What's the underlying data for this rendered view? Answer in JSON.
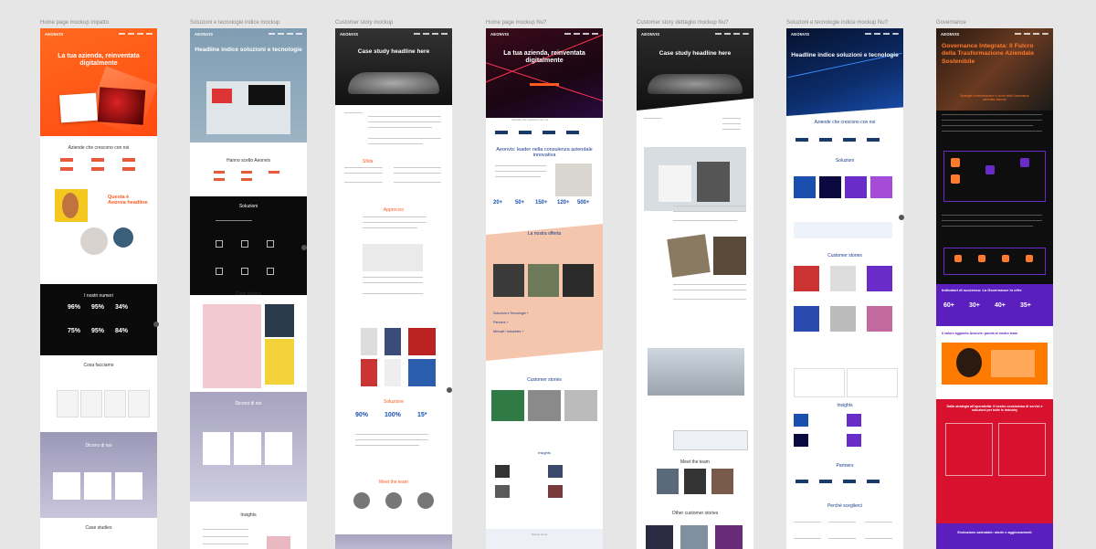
{
  "boards": [
    {
      "label": "Home page mockup impatto",
      "logo": "AEONVIS",
      "hero": "La tua azienda, reinventata digitalmente",
      "sec1": "Aziende che crescono con noi",
      "feature": "Questa è Aeonva headline",
      "numbers": "I nostri numeri",
      "stats": [
        "96%",
        "95%",
        "34%",
        "75%",
        "95%",
        "84%"
      ],
      "cosa": "Cosa facciamo",
      "dicono": "Dicono di noi",
      "case": "Case studies"
    },
    {
      "label": "Soluzioni e tecnologie indice mockup",
      "logo": "AEONVIS",
      "hero": "Headline indice soluzioni e tecnologie",
      "sec1": "Hanno scelto Aeonvis",
      "soluzioni": "Soluzioni",
      "case": "Case studies",
      "dicono": "Dicono di noi",
      "insights": "Insights"
    },
    {
      "label": "Customer story mockup",
      "logo": "AEONVIS",
      "hero": "Case study headline here",
      "sfida": "Sfida",
      "approccio": "Approccio",
      "soluzione": "Soluzione",
      "stats": [
        "90%",
        "100%",
        "15*"
      ],
      "team": "Meet the team"
    },
    {
      "label": "Home page mockup Nu?",
      "logo": "AEONVIS",
      "hero": "La tua azienda, reinventata digitalmente",
      "sec1": "Aziende che crescono con noi",
      "leader": "Aeonvis: leader nella consulenza aziendale innovativa",
      "stats": [
        "20+",
        "50+",
        "150+",
        "120+",
        "500+"
      ],
      "offerte": "La nostra offerta",
      "links": [
        "Soluzioni e Tecnologie +",
        "Partners +",
        "Mercati / Industries +"
      ],
      "stories": "Customer stories",
      "insights": "Insights",
      "dicono": "Dicono di noi"
    },
    {
      "label": "Customer story dettaglio mockup Nu?",
      "logo": "AEONVIS",
      "hero": "Case study headline here",
      "team": "Meet the team",
      "other": "Other customer stories"
    },
    {
      "label": "Soluzioni e tecnologie indice mockup Nu?",
      "logo": "AEONVIS",
      "hero": "Headline indice soluzioni e tecnologie",
      "sec1": "Aziende che crescono con noi",
      "soluzioni": "Soluzioni",
      "stories": "Customer stories",
      "insights": "Insights",
      "partners": "Partners",
      "perche": "Perché sceglierci"
    },
    {
      "label": "Governance",
      "logo": "AEONVIS",
      "hero": "Governance Integrata: Il Fulcro della Trasformazione Aziendale Sostenibile",
      "subhead": "Strategie e trasformazione: il cuore della Governance aziendale Aeonvis",
      "indicatori": "Indicatori di successo: La Governance in cifre",
      "stats": [
        "60+",
        "30+",
        "40+",
        "35+"
      ],
      "valore": "Il valore aggiunto Aeonvis: parola al nostro team",
      "strategia": "Dalla strategia all'operatività: Il nostro ecosistema di servizi e soluzioni per tutte le Industry",
      "evaluation": "Evoluzione aziendale: storie e aggiornamenti"
    }
  ],
  "colors": {
    "orange": "#ff5a1f",
    "purple": "#6a2cc9",
    "navy": "#0d1a3a",
    "dark": "#101010",
    "peach": "#f2c3aa",
    "lavender": "#a9a6c2",
    "blue_gray": "#8aa1b5"
  }
}
